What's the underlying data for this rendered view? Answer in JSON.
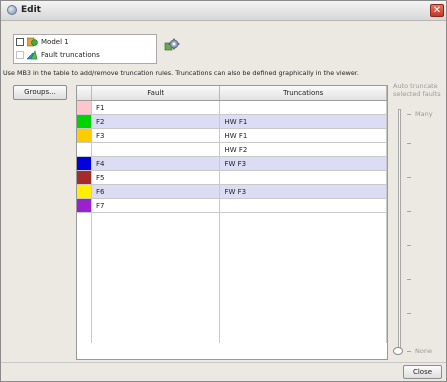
{
  "window": {
    "title": "Edit",
    "close_glyph": "✕"
  },
  "tree": {
    "items": [
      {
        "label": "Model 1",
        "icon": "model-icon",
        "checked": false
      },
      {
        "label": "Fault truncations",
        "icon": "fault-truncations-icon",
        "checked": false
      }
    ]
  },
  "settings_icon": "gear-icon",
  "instruction": "Use MB3 in the table to add/remove truncation rules.  Truncations can also be defined graphically in the viewer.",
  "groups_button": "Groups...",
  "table": {
    "headers": [
      "Fault",
      "Truncations"
    ],
    "rows": [
      {
        "name": "F1",
        "color": "#ffc4cc",
        "truncations": "",
        "selected": false
      },
      {
        "name": "F2",
        "color": "#00d400",
        "truncations": "HW F1",
        "selected": true
      },
      {
        "name": "F3",
        "color": "#ffcc00",
        "truncations": "HW F1",
        "selected": false
      },
      {
        "name": "",
        "color": "",
        "truncations": "HW F2",
        "selected": false
      },
      {
        "name": "F4",
        "color": "#0000dd",
        "truncations": "FW F3",
        "selected": true
      },
      {
        "name": "F5",
        "color": "#a52a2a",
        "truncations": "",
        "selected": false
      },
      {
        "name": "F6",
        "color": "#ffee00",
        "truncations": "FW F3",
        "selected": true
      },
      {
        "name": "F7",
        "color": "#9922cc",
        "truncations": "",
        "selected": false
      }
    ]
  },
  "auto_truncate": {
    "label_line1": "Auto truncate",
    "label_line2": "selected faults",
    "top_label": "Many",
    "bottom_label": "None",
    "level": 0
  },
  "close_button": "Close"
}
